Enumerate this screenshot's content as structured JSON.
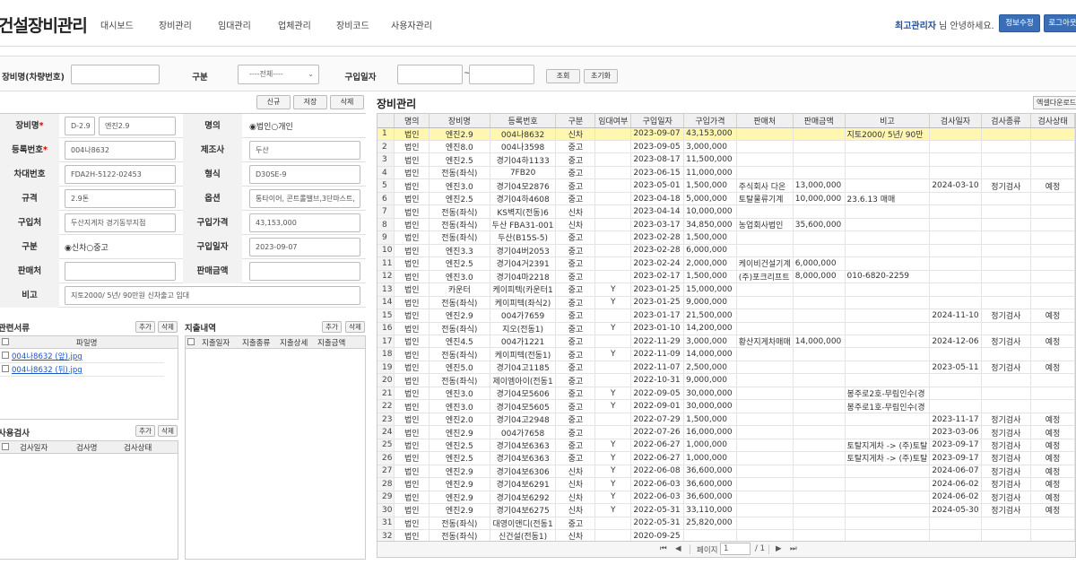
{
  "header": {
    "title": "건설장비관리",
    "nav": [
      "대시보드",
      "장비관리",
      "임대관리",
      "업체관리",
      "장비코드",
      "사용자관리"
    ],
    "user": "최고관리자",
    "greeting": " 님 안녕하세요.",
    "btn_profile": "정보수정",
    "btn_logout": "로그아웃"
  },
  "search": {
    "label_name": "장비명(차량번호)",
    "label_type": "구분",
    "type_value": "----전체----",
    "label_date": "구입일자",
    "date_sep": "~",
    "btn_search": "조회",
    "btn_reset": "초기화"
  },
  "form_buttons": {
    "new": "신규",
    "save": "저장",
    "delete": "삭제"
  },
  "form": {
    "equip_label": "장비명",
    "equip_v1": "D-2.9",
    "equip_v2": "엔진2.9",
    "owner_label": "명의",
    "owner_opt1": "법인",
    "owner_opt2": "개인",
    "reg_label": "등록번호",
    "reg_value": "004나8632",
    "maker_label": "제조사",
    "maker_value": "두산",
    "chassis_label": "차대번호",
    "chassis_value": "FDA2H-5122-02453",
    "model_label": "형식",
    "model_value": "D30SE-9",
    "spec_label": "규격",
    "spec_value": "2.9톤",
    "option_label": "옵션",
    "option_value": "통타이어, 콘트롤밸브,3단마스트,",
    "buyer_label": "구입처",
    "buyer_value": "두산지게차 경기동부지점",
    "price_label": "구입가격",
    "price_value": "43,153,000",
    "kind_label": "구분",
    "kind_opt1": "신차",
    "kind_opt2": "중고",
    "date_label": "구입일자",
    "date_value": "2023-09-07",
    "seller_label": "판매처",
    "sale_label": "판매금액",
    "memo_label": "비고",
    "memo_value": "지토2000/ 5년/ 90만원 신차출고 임대"
  },
  "docs": {
    "title": "관련서류",
    "add": "추가",
    "del": "삭제",
    "col": "파일명",
    "files": [
      "004나8632 (앞).jpg",
      "004나8632 (뒤).jpg"
    ]
  },
  "expense": {
    "title": "지출내역",
    "add": "추가",
    "del": "삭제",
    "cols": [
      "지출일자",
      "지출종류",
      "지출상세",
      "지출금액"
    ]
  },
  "inspection": {
    "title": "사용검사",
    "add": "추가",
    "del": "삭제",
    "cols": [
      "검사일자",
      "검사명",
      "검사상태"
    ]
  },
  "grid": {
    "title": "장비관리",
    "excel": "엑셀다운로드",
    "columns": [
      "",
      "명의",
      "장비명",
      "등록번호",
      "구분",
      "임대여부",
      "구입일자",
      "구입가격",
      "판매처",
      "판매금액",
      "비고",
      "검사일자",
      "검사종류",
      "검사상태"
    ],
    "rows": [
      [
        "1",
        "법인",
        "엔진2.9",
        "004나8632",
        "신차",
        "",
        "2023-09-07",
        "43,153,000",
        "",
        "",
        "지토2000/ 5년/ 90만",
        "",
        "",
        ""
      ],
      [
        "2",
        "법인",
        "엔진8.0",
        "004나3598",
        "중고",
        "",
        "2023-09-05",
        "3,000,000",
        "",
        "",
        "",
        "",
        "",
        ""
      ],
      [
        "3",
        "법인",
        "엔진2.5",
        "경기04하1133",
        "중고",
        "",
        "2023-08-17",
        "11,500,000",
        "",
        "",
        "",
        "",
        "",
        ""
      ],
      [
        "4",
        "법인",
        "전동(좌식)",
        "7FB20",
        "중고",
        "",
        "2023-06-15",
        "11,000,000",
        "",
        "",
        "",
        "",
        "",
        ""
      ],
      [
        "5",
        "법인",
        "엔진3.0",
        "경기04모2876",
        "중고",
        "",
        "2023-05-01",
        "1,500,000",
        "주식회사 다온",
        "13,000,000",
        "",
        "2024-03-10",
        "정기검사",
        "예정"
      ],
      [
        "6",
        "법인",
        "엔진2.5",
        "경기04하4608",
        "중고",
        "",
        "2023-04-18",
        "5,000,000",
        "토탈물류기계",
        "10,000,000",
        "23.6.13 매매",
        "",
        "",
        ""
      ],
      [
        "7",
        "법인",
        "전동(좌식)",
        "KS벽지(전동)6",
        "신차",
        "",
        "2023-04-14",
        "10,000,000",
        "",
        "",
        "",
        "",
        "",
        ""
      ],
      [
        "8",
        "법인",
        "전동(좌식)",
        "두산 FBA31-001",
        "신차",
        "",
        "2023-03-17",
        "34,850,000",
        "농업회사법인",
        "35,600,000",
        "",
        "",
        "",
        ""
      ],
      [
        "9",
        "법인",
        "전동(좌식)",
        "두산(B15S-5)",
        "중고",
        "",
        "2023-02-28",
        "1,500,000",
        "",
        "",
        "",
        "",
        "",
        ""
      ],
      [
        "10",
        "법인",
        "엔진3.3",
        "경기04버2053",
        "중고",
        "",
        "2023-02-28",
        "6,000,000",
        "",
        "",
        "",
        "",
        "",
        ""
      ],
      [
        "11",
        "법인",
        "엔진2.5",
        "경기04거2391",
        "중고",
        "",
        "2023-02-24",
        "2,000,000",
        "케이비건설기계",
        "6,000,000",
        "",
        "",
        "",
        ""
      ],
      [
        "12",
        "법인",
        "엔진3.0",
        "경기04마2218",
        "중고",
        "",
        "2023-02-17",
        "1,500,000",
        "(주)포크리프트",
        "8,000,000",
        "010-6820-2259",
        "",
        "",
        ""
      ],
      [
        "13",
        "법인",
        "카운터",
        "케이피텍(카운터1",
        "중고",
        "Y",
        "2023-01-25",
        "15,000,000",
        "",
        "",
        "",
        "",
        "",
        ""
      ],
      [
        "14",
        "법인",
        "전동(좌식)",
        "케이피텍(좌식2)",
        "중고",
        "Y",
        "2023-01-25",
        "9,000,000",
        "",
        "",
        "",
        "",
        "",
        ""
      ],
      [
        "15",
        "법인",
        "엔진2.9",
        "004가7659",
        "중고",
        "",
        "2023-01-17",
        "21,500,000",
        "",
        "",
        "",
        "2024-11-10",
        "정기검사",
        "예정"
      ],
      [
        "16",
        "법인",
        "전동(좌식)",
        "지오(전동1)",
        "중고",
        "Y",
        "2023-01-10",
        "14,200,000",
        "",
        "",
        "",
        "",
        "",
        ""
      ],
      [
        "17",
        "법인",
        "엔진4.5",
        "004가1221",
        "중고",
        "",
        "2022-11-29",
        "3,000,000",
        "황산지게차매매",
        "14,000,000",
        "",
        "2024-12-06",
        "정기검사",
        "예정"
      ],
      [
        "18",
        "법인",
        "전동(좌식)",
        "케이피텍(전동1)",
        "중고",
        "Y",
        "2022-11-09",
        "14,000,000",
        "",
        "",
        "",
        "",
        "",
        ""
      ],
      [
        "19",
        "법인",
        "엔진5.0",
        "경기04고1185",
        "중고",
        "",
        "2022-11-07",
        "2,500,000",
        "",
        "",
        "",
        "2023-05-11",
        "정기검사",
        "예정"
      ],
      [
        "20",
        "법인",
        "전동(좌식)",
        "제이엠아이(전동1",
        "중고",
        "",
        "2022-10-31",
        "9,000,000",
        "",
        "",
        "",
        "",
        "",
        ""
      ],
      [
        "21",
        "법인",
        "엔진3.0",
        "경기04모5606",
        "중고",
        "Y",
        "2022-09-05",
        "30,000,000",
        "",
        "",
        "봉주로2호-무림인수(경",
        "",
        "",
        ""
      ],
      [
        "22",
        "법인",
        "엔진3.0",
        "경기04모5605",
        "중고",
        "Y",
        "2022-09-01",
        "30,000,000",
        "",
        "",
        "봉주로1호-무림인수(경",
        "",
        "",
        ""
      ],
      [
        "23",
        "법인",
        "엔진2.0",
        "경기04고2948",
        "중고",
        "",
        "2022-07-29",
        "1,500,000",
        "",
        "",
        "",
        "2023-11-17",
        "정기검사",
        "예정"
      ],
      [
        "24",
        "법인",
        "엔진2.9",
        "004가7658",
        "중고",
        "",
        "2022-07-26",
        "16,000,000",
        "",
        "",
        "",
        "2023-03-06",
        "정기검사",
        "예정"
      ],
      [
        "25",
        "법인",
        "엔진2.5",
        "경기04보6363",
        "중고",
        "Y",
        "2022-06-27",
        "1,000,000",
        "",
        "",
        "토탈지게차 -> (주)토탈",
        "2023-09-17",
        "정기검사",
        "예정"
      ],
      [
        "26",
        "법인",
        "엔진2.5",
        "경기04보6363",
        "중고",
        "Y",
        "2022-06-27",
        "1,000,000",
        "",
        "",
        "토탈지게차 -> (주)토탈",
        "2023-09-17",
        "정기검사",
        "예정"
      ],
      [
        "27",
        "법인",
        "엔진2.9",
        "경기04보6306",
        "신차",
        "Y",
        "2022-06-08",
        "36,600,000",
        "",
        "",
        "",
        "2024-06-07",
        "정기검사",
        "예정"
      ],
      [
        "28",
        "법인",
        "엔진2.9",
        "경기04보6291",
        "신차",
        "Y",
        "2022-06-03",
        "36,600,000",
        "",
        "",
        "",
        "2024-06-02",
        "정기검사",
        "예정"
      ],
      [
        "29",
        "법인",
        "엔진2.9",
        "경기04보6292",
        "신차",
        "Y",
        "2022-06-03",
        "36,600,000",
        "",
        "",
        "",
        "2024-06-02",
        "정기검사",
        "예정"
      ],
      [
        "30",
        "법인",
        "엔진2.9",
        "경기04보6275",
        "신차",
        "Y",
        "2022-05-31",
        "33,110,000",
        "",
        "",
        "",
        "2024-05-30",
        "정기검사",
        "예정"
      ],
      [
        "31",
        "법인",
        "전동(좌식)",
        "대영이앤디(전동1",
        "중고",
        "",
        "2022-05-31",
        "25,820,000",
        "",
        "",
        "",
        "",
        "",
        ""
      ],
      [
        "32",
        "법인",
        "전동(좌식)",
        "신건설(전동1)",
        "신차",
        "",
        "2020-09-25",
        "",
        "",
        "",
        "",
        "",
        "",
        ""
      ]
    ]
  },
  "pager": {
    "first": "⏮",
    "prev": "◀",
    "label": "페이지",
    "current": "1",
    "total": "/ 1",
    "next": "▶",
    "last": "⏭"
  }
}
